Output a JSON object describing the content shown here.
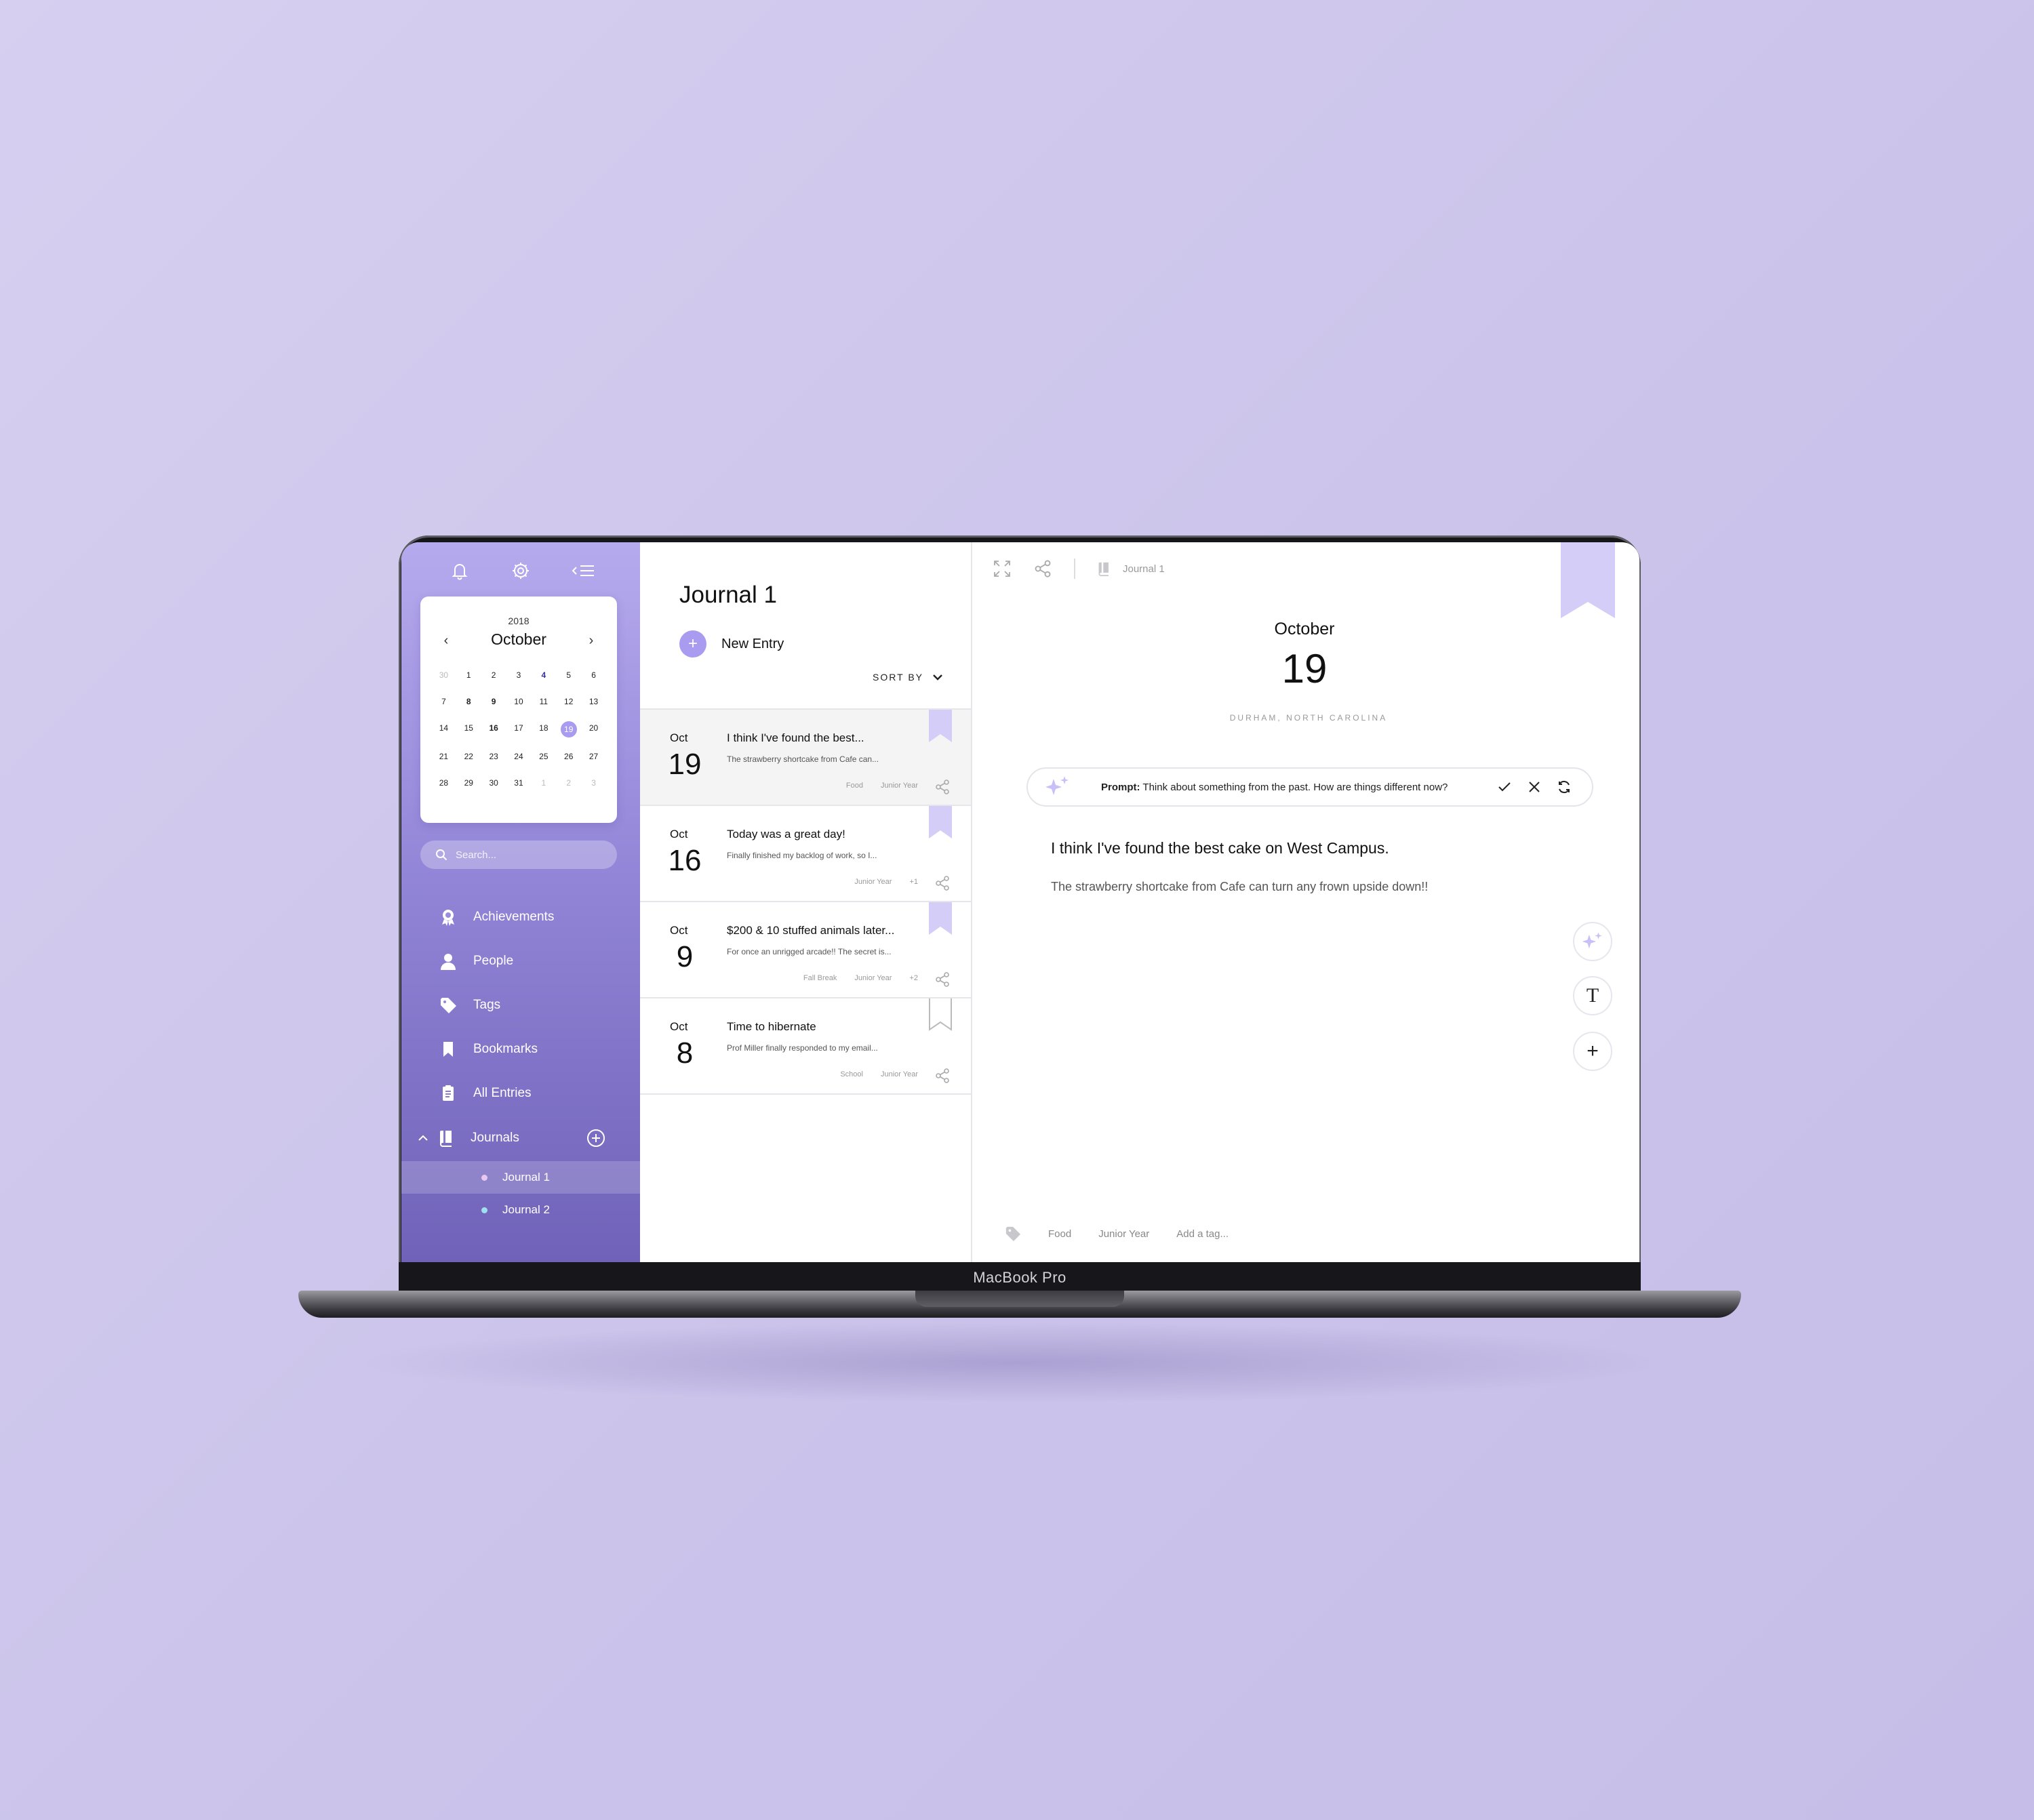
{
  "device_label": "MacBook Pro",
  "sidebar": {
    "icons": [
      "bell-icon",
      "gear-icon",
      "collapse-menu-icon"
    ],
    "calendar": {
      "year": "2018",
      "month": "October",
      "prev": "‹",
      "next": "›",
      "weeks": [
        [
          "30",
          "1",
          "2",
          "3",
          "4",
          "5",
          "6"
        ],
        [
          "7",
          "8",
          "9",
          "10",
          "11",
          "12",
          "13"
        ],
        [
          "14",
          "15",
          "16",
          "17",
          "18",
          "19",
          "20"
        ],
        [
          "21",
          "22",
          "23",
          "24",
          "25",
          "26",
          "27"
        ],
        [
          "28",
          "29",
          "30",
          "31",
          "1",
          "2",
          "3"
        ]
      ],
      "selected_day": "19"
    },
    "search_placeholder": "Search...",
    "nav": [
      {
        "label": "Achievements",
        "icon": "award-icon"
      },
      {
        "label": "People",
        "icon": "person-icon"
      },
      {
        "label": "Tags",
        "icon": "tag-icon"
      },
      {
        "label": "Bookmarks",
        "icon": "bookmark-icon"
      },
      {
        "label": "All Entries",
        "icon": "entries-icon"
      }
    ],
    "journals_label": "Journals",
    "journals": [
      {
        "label": "Journal 1",
        "dot_color": "#e9c8ef",
        "active": true
      },
      {
        "label": "Journal 2",
        "dot_color": "#9fe0f0",
        "active": false
      }
    ]
  },
  "list": {
    "title": "Journal 1",
    "new_entry": "New Entry",
    "sort_by": "SORT BY",
    "entries": [
      {
        "month": "Oct",
        "day": "19",
        "title": "I think I've found the best...",
        "preview": "The strawberry shortcake from Cafe can...",
        "tags": [
          "Food",
          "Junior Year"
        ],
        "bookmarked": true,
        "selected": true
      },
      {
        "month": "Oct",
        "day": "16",
        "title": "Today was a great day!",
        "preview": "Finally finished my backlog of work, so I...",
        "tags": [
          "Junior Year",
          "+1"
        ],
        "bookmarked": true,
        "selected": false
      },
      {
        "month": "Oct",
        "day": "9",
        "title": "$200 & 10 stuffed animals later...",
        "preview": "For once an unrigged arcade!! The secret is...",
        "tags": [
          "Fall Break",
          "Junior Year",
          "+2"
        ],
        "bookmarked": true,
        "selected": false
      },
      {
        "month": "Oct",
        "day": "8",
        "title": "Time to hibernate",
        "preview": "Prof Miller finally responded to my email...",
        "tags": [
          "School",
          "Junior Year"
        ],
        "bookmarked": false,
        "selected": false
      }
    ]
  },
  "main": {
    "journal_label": "Journal 1",
    "date_month": "October",
    "date_day": "19",
    "location": "DURHAM, NORTH CAROLINA",
    "prompt_label": "Prompt:",
    "prompt_text": "Think about something from the past. How are things different now?",
    "entry_title": "I think I've found the best cake on West Campus.",
    "entry_body": "The strawberry shortcake from Cafe can turn any frown upside down!!",
    "tags": [
      "Food",
      "Junior Year"
    ],
    "add_tag_placeholder": "Add a tag..."
  },
  "colors": {
    "accent": "#a99bf0",
    "sidebar_top": "#b6aaee",
    "sidebar_bottom": "#6f62b8",
    "bookmark": "#d4cdf7",
    "background": "#d0c8ee"
  }
}
